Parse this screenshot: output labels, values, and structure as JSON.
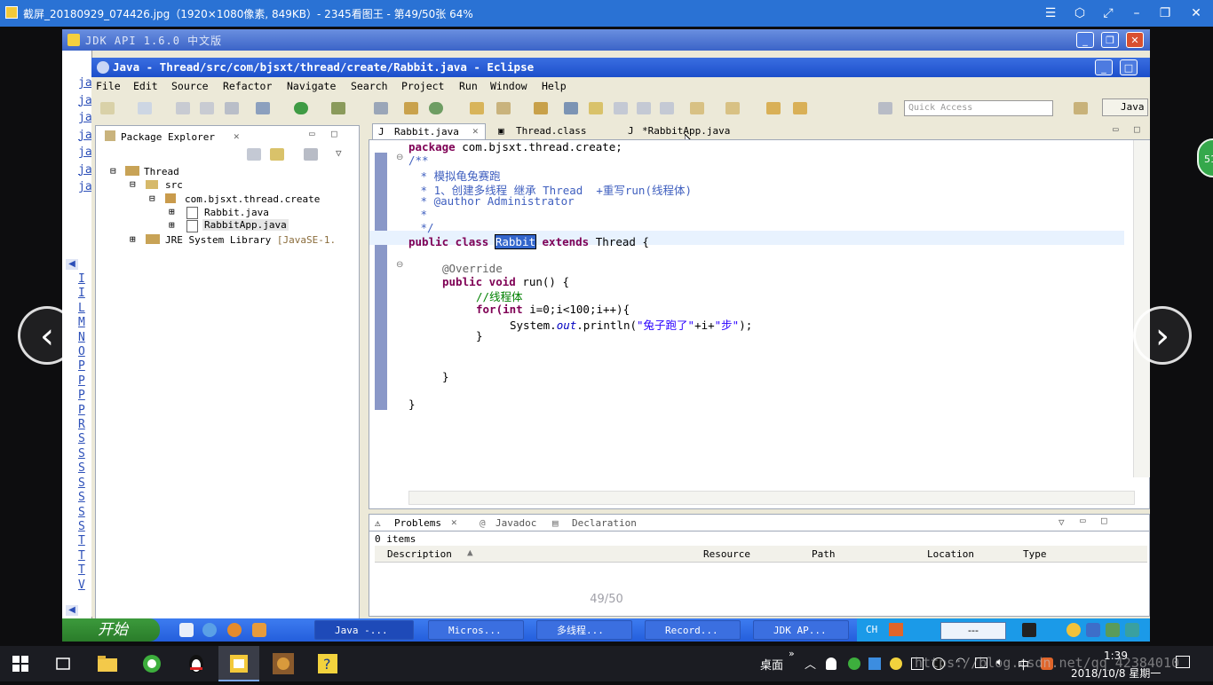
{
  "viewer": {
    "title": "截屏_20180929_074426.jpg（1920×1080像素, 849KB）- 2345看图王 - 第49/50张 64%",
    "counter": "49/50",
    "controls": [
      "menu-icon",
      "skin-icon",
      "fullscreen-icon",
      "minimize-icon",
      "restore-icon",
      "close-icon"
    ]
  },
  "jdk": {
    "title": "JDK API 1.6.0 中文版",
    "side_links_top": [
      "ja",
      "ja",
      "ja",
      "ja",
      "ja",
      "ja",
      "ja"
    ],
    "side_links_bottom": [
      "I",
      "I",
      "L",
      "M",
      "N",
      "O",
      "P",
      "P",
      "P",
      "P",
      "R",
      "S",
      "S",
      "S",
      "S",
      "S",
      "S",
      "S",
      "T",
      "T",
      "T",
      "V"
    ]
  },
  "eclipse": {
    "title": "Java - Thread/src/com/bjsxt/thread/create/Rabbit.java - Eclipse",
    "menu": [
      "File",
      "Edit",
      "Source",
      "Refactor",
      "Navigate",
      "Search",
      "Project",
      "Run",
      "Window",
      "Help"
    ],
    "quick_access": "Quick Access",
    "perspective": "Java",
    "package_explorer": {
      "tab": "Package Explorer",
      "tree": [
        {
          "label": "Thread"
        },
        {
          "label": "src"
        },
        {
          "label": "com.bjsxt.thread.create"
        },
        {
          "label": "Rabbit.java"
        },
        {
          "label": "RabbitApp.java"
        },
        {
          "label": "JRE System Library",
          "suffix": "[JavaSE-1."
        }
      ]
    },
    "editor_tabs": [
      "Rabbit.java",
      "Thread.class",
      "*RabbitApp.java"
    ],
    "code": {
      "l1_kw": "package",
      "l1_rest": " com.bjsxt.thread.create;",
      "l2": "/**",
      "l3": " * 模拟龟兔赛跑",
      "l4": " * 1、创建多线程 继承 Thread  +重写run(线程体)",
      "l5": " * @author Administrator",
      "l6": " *",
      "l7": " */",
      "l8_kw": "public class",
      "l8_sel": "Rabbit",
      "l8_kw2": "extends",
      "l8_rest": " Thread {",
      "l9": "@Override",
      "l10_kw": "public void",
      "l10_rest": " run() {",
      "l11": "//线程体",
      "l12_kw": "for(int",
      "l12_rest": " i=0;i<100;i++){",
      "l13_a": "System.",
      "l13_out": "out",
      "l13_b": ".println(",
      "l13_s1": "\"兔子跑了\"",
      "l13_c": "+i+",
      "l13_s2": "\"步\"",
      "l13_d": ");",
      "l14": "}",
      "l15": "}",
      "l16": "}"
    },
    "bottom_tabs": [
      "Problems",
      "Javadoc",
      "Declaration"
    ],
    "problems_count": "0 items",
    "columns": [
      "Description",
      "Resource",
      "Path",
      "Location",
      "Type"
    ]
  },
  "xp_taskbar": {
    "start": "开始",
    "tasks": [
      "Java -...",
      "Micros...",
      "多线程...",
      "Record...",
      "JDK AP..."
    ],
    "lang": "CH",
    "clock_field": "---"
  },
  "win_taskbar": {
    "desktop": "桌面",
    "ime": "中",
    "time": "1:39",
    "date": "2018/10/8 星期一",
    "watermark": "https://blog.csdn.net/qq_42384010"
  },
  "side_badge": "51"
}
